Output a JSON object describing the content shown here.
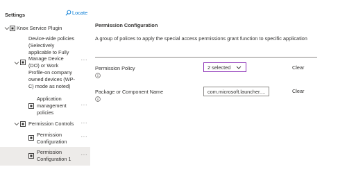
{
  "sidebar": {
    "title": "Settings",
    "locate_label": "Locate",
    "items": [
      {
        "label": "Knox Service Plugin"
      },
      {
        "label_lines": [
          "Device-wide policies",
          "(Selectively",
          "applicable to Fully"
        ]
      },
      {
        "label_lines": [
          "Manage Device",
          "(DO) or Work",
          "Profile-on company",
          "owned devices (WP-",
          "C) mode as noted)"
        ],
        "more": "···"
      },
      {
        "label_lines": [
          "Application",
          "management",
          "policies"
        ],
        "more": "···"
      },
      {
        "label": "Permission Controls",
        "more": "···"
      },
      {
        "label_lines": [
          "Permission",
          "Configuration"
        ],
        "more": "···"
      },
      {
        "label_lines": [
          "Permission",
          "Configuration 1"
        ],
        "more": "···",
        "selected": true
      }
    ]
  },
  "main": {
    "title": "Permission Configuration",
    "description": "A group of polices to apply the special access permissions grant function to specific application",
    "fields": [
      {
        "label": "Permission Policy",
        "value": "2 selected",
        "clear_label": "Clear"
      },
      {
        "label": "Package or Component Name",
        "value": "com.microsoft.launcher....",
        "clear_label": "Clear"
      }
    ]
  },
  "colors": {
    "accent": "#0078d4",
    "dropdown_border": "#8a2fb5",
    "selected_bg": "#edebe9"
  }
}
